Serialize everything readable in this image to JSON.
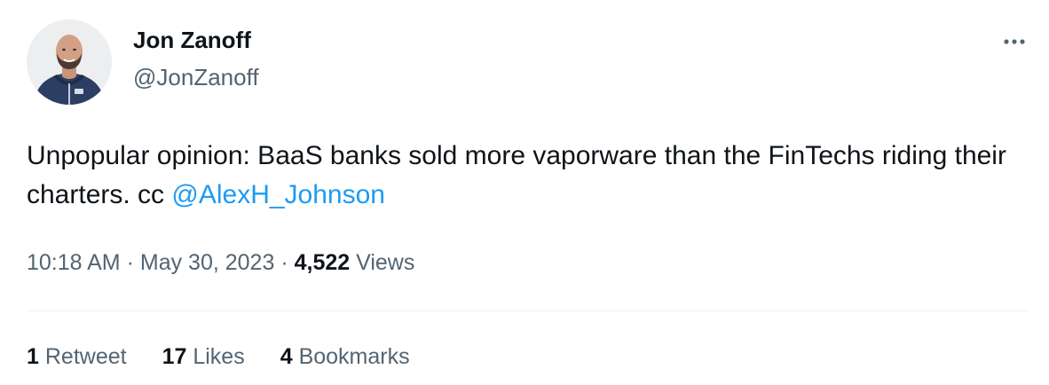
{
  "author": {
    "display_name": "Jon Zanoff",
    "handle": "@JonZanoff"
  },
  "tweet": {
    "text_before": "Unpopular opinion:  BaaS banks sold more vaporware than the FinTechs riding their charters. cc ",
    "mention": "@AlexH_Johnson"
  },
  "meta": {
    "time": "10:18 AM",
    "separator": "·",
    "date": "May 30, 2023",
    "views_count": "4,522",
    "views_label": "Views"
  },
  "stats": {
    "retweets_count": "1",
    "retweets_label": "Retweet",
    "likes_count": "17",
    "likes_label": "Likes",
    "bookmarks_count": "4",
    "bookmarks_label": "Bookmarks"
  },
  "icons": {
    "more": "more-horizontal-icon"
  },
  "colors": {
    "primary_text": "#0f1419",
    "secondary_text": "#536471",
    "link": "#1d9bf0",
    "divider": "#eff3f4"
  }
}
